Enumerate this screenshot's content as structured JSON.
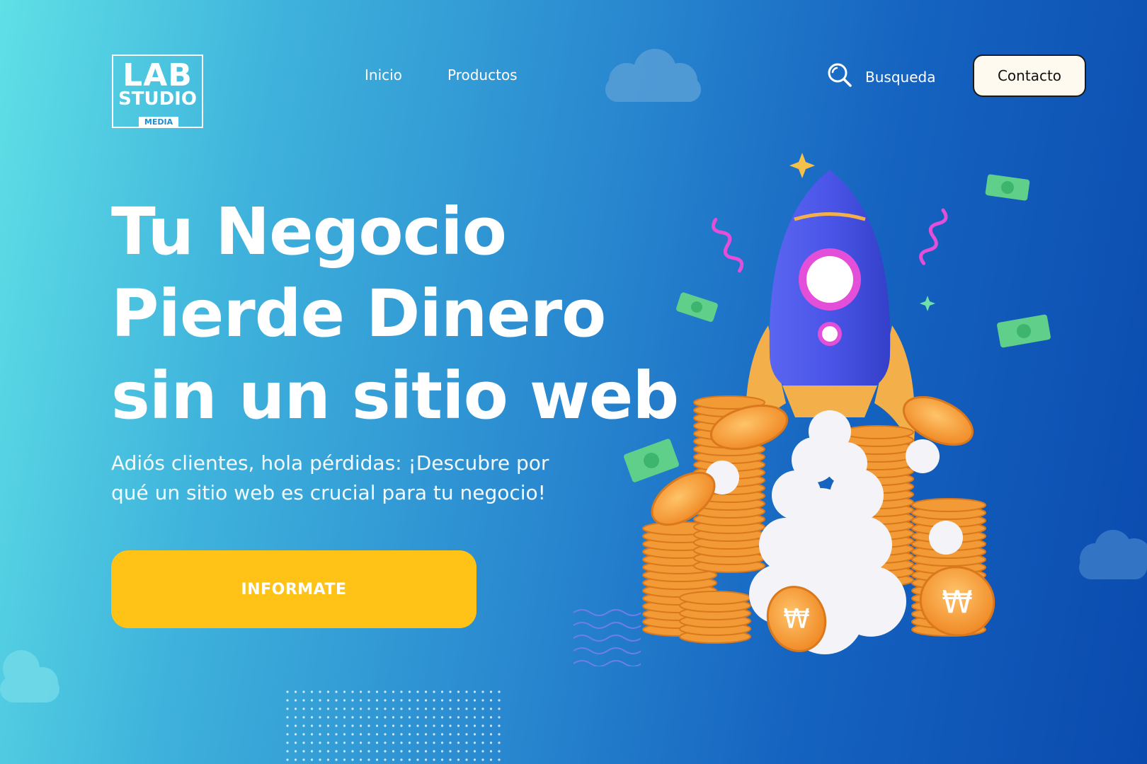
{
  "brand": {
    "logo_line1": "LAB",
    "logo_line2": "STUDIO",
    "logo_tag": "MEDIA"
  },
  "nav": {
    "items": [
      {
        "label": "Inicio"
      },
      {
        "label": "Productos"
      }
    ]
  },
  "search": {
    "label": "Busqueda",
    "icon": "search-icon"
  },
  "contact": {
    "label": "Contacto"
  },
  "hero": {
    "headline_lines": [
      "Tu Negocio",
      "Pierde Dinero",
      "sin un sitio web"
    ],
    "subtitle": "Adiós clientes, hola pérdidas: ¡Descubre por qué un sitio web es crucial para tu negocio!",
    "cta_label": "INFORMATE"
  },
  "colors": {
    "cta": "#fec316",
    "rocket": "#4a55e8",
    "coin": "#f5a23c",
    "bill": "#5fcf8a",
    "accent_pink": "#e34fd8"
  }
}
